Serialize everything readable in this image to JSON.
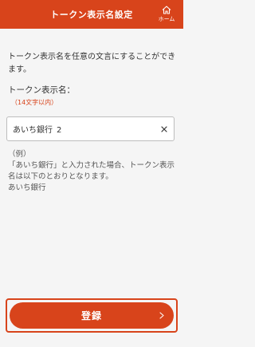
{
  "header": {
    "title": "トークン表示名設定",
    "home_label": "ホーム",
    "home_icon": "home-icon"
  },
  "intro": "トークン表示名を任意の文言にすることができます。",
  "field": {
    "label": "トークン表示名：",
    "note": "（14文字以内）",
    "value": "あいち銀行_2",
    "clear_icon": "close-icon"
  },
  "example": {
    "heading": "（例）",
    "line1": "「あいち銀行」と入力された場合、トークン表示名は以下のとおりとなります。",
    "line2": "あいち銀行"
  },
  "submit": {
    "label": "登録",
    "icon": "chevron-right-icon"
  },
  "colors": {
    "accent": "#d8441b",
    "background": "#f5f5f5"
  }
}
